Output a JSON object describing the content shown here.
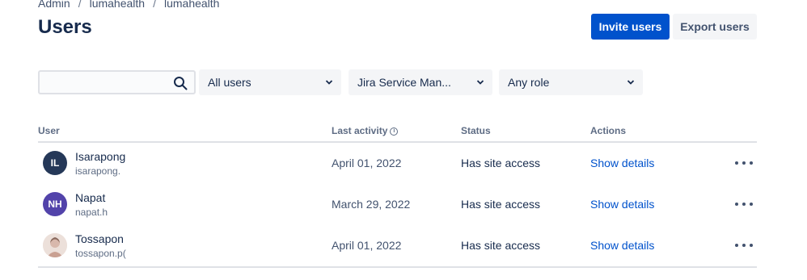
{
  "breadcrumb": [
    "Admin",
    "lumahealth",
    "lumahealth"
  ],
  "breadcrumb_sep": "/",
  "title": "Users",
  "actions": {
    "invite": "Invite users",
    "export": "Export users"
  },
  "filters": {
    "search_placeholder": "",
    "user_type": "All users",
    "product": "Jira Service Man...",
    "role": "Any role"
  },
  "table": {
    "columns": {
      "user": "User",
      "last_activity": "Last activity",
      "status": "Status",
      "actions": "Actions"
    },
    "rows": [
      {
        "initials": "IL",
        "name": "Isarapong",
        "email": "isarapong.",
        "activity": "April 01, 2022",
        "status": "Has site access",
        "action": "Show details"
      },
      {
        "initials": "NH",
        "name": "Napat",
        "email": "napat.h",
        "activity": "March 29, 2022",
        "status": "Has site access",
        "action": "Show details"
      },
      {
        "initials": "",
        "name": "Tossapon",
        "email": "tossapon.p(",
        "activity": "April 01, 2022",
        "status": "Has site access",
        "action": "Show details"
      }
    ]
  },
  "colors": {
    "primary": "#0052cc",
    "text": "#172b4d",
    "subtle": "#5e6c84",
    "border": "#dfe1e6"
  }
}
